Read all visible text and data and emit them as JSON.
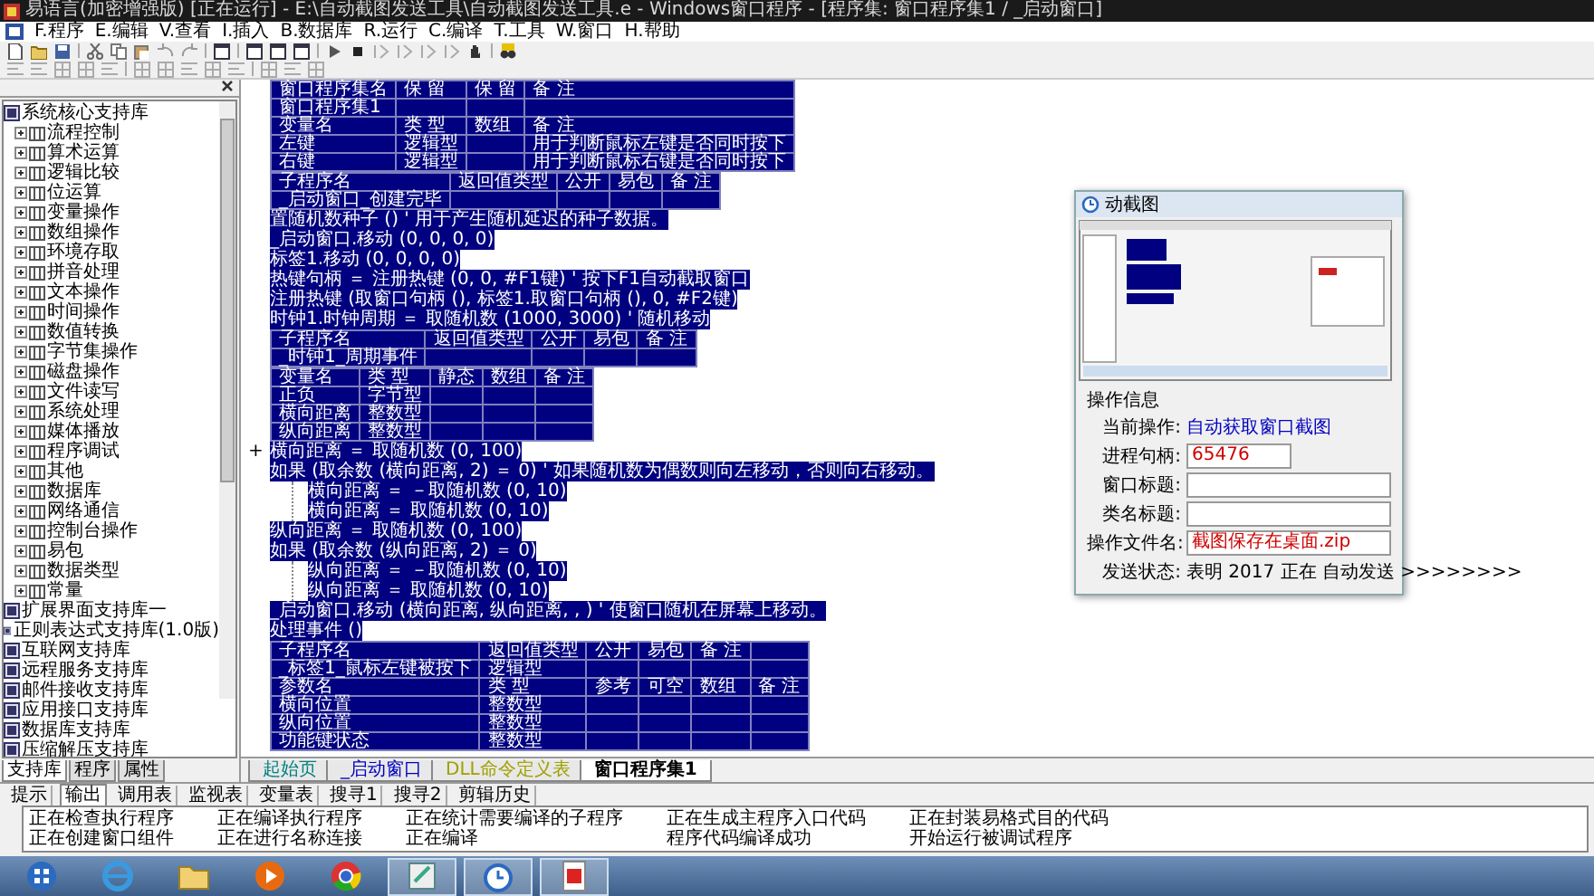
{
  "window": {
    "title": "易语言(加密增强版) [正在运行] - E:\\自动截图发送工具\\自动截图发送工具.e - Windows窗口程序 - [程序集: 窗口程序集1 / _启动窗口]"
  },
  "menu": [
    "F.程序",
    "E.编辑",
    "V.查看",
    "I.插入",
    "B.数据库",
    "R.运行",
    "C.编译",
    "T.工具",
    "W.窗口",
    "H.帮助"
  ],
  "library_panel": {
    "tree": [
      {
        "label": "系统核心支持库",
        "children": [
          {
            "label": "流程控制",
            "expanded": false
          },
          {
            "label": "算术运算",
            "expanded": false
          },
          {
            "label": "逻辑比较",
            "expanded": false
          },
          {
            "label": "位运算",
            "expanded": false
          },
          {
            "label": "变量操作",
            "expanded": false
          },
          {
            "label": "数组操作",
            "expanded": false
          },
          {
            "label": "环境存取",
            "expanded": false
          },
          {
            "label": "拼音处理",
            "expanded": false
          },
          {
            "label": "文本操作",
            "expanded": false
          },
          {
            "label": "时间操作",
            "expanded": false
          },
          {
            "label": "数值转换",
            "expanded": false
          },
          {
            "label": "字节集操作",
            "expanded": false
          },
          {
            "label": "磁盘操作",
            "expanded": false
          },
          {
            "label": "文件读写",
            "expanded": false
          },
          {
            "label": "系统处理",
            "expanded": false
          },
          {
            "label": "媒体播放",
            "expanded": false
          },
          {
            "label": "程序调试",
            "expanded": false
          },
          {
            "label": "其他",
            "expanded": false
          },
          {
            "label": "数据库",
            "expanded": false
          },
          {
            "label": "网络通信",
            "expanded": false
          },
          {
            "label": "控制台操作",
            "expanded": false
          },
          {
            "label": "易包",
            "expanded": false
          },
          {
            "label": "数据类型",
            "expanded": false
          },
          {
            "label": "常量",
            "expanded": false
          }
        ]
      },
      {
        "label": "扩展界面支持库一"
      },
      {
        "label": "正则表达式支持库(1.0版)"
      },
      {
        "label": "互联网支持库"
      },
      {
        "label": "远程服务支持库"
      },
      {
        "label": "邮件接收支持库"
      },
      {
        "label": "应用接口支持库"
      },
      {
        "label": "数据库支持库"
      },
      {
        "label": "压缩解压支持库"
      }
    ],
    "tabs": [
      {
        "label": "支持库",
        "selected": true
      },
      {
        "label": "程序",
        "selected": false
      },
      {
        "label": "属性",
        "selected": false
      }
    ]
  },
  "editor": {
    "blocks": [
      {
        "kind": "table",
        "rows": [
          {
            "cells": [
              "窗口程序集名",
              "保 留",
              "保 留",
              "备 注"
            ]
          },
          {
            "cells": [
              "窗口程序集1",
              "",
              "",
              ""
            ]
          },
          {
            "cells": [
              "变量名",
              "类 型",
              "数组",
              "备 注"
            ]
          },
          {
            "cells": [
              "左键",
              "逻辑型",
              "",
              "用于判断鼠标左键是否同时按下"
            ]
          },
          {
            "cells": [
              "右键",
              "逻辑型",
              "",
              "用于判断鼠标右键是否同时按下"
            ]
          }
        ]
      },
      {
        "kind": "table",
        "rows": [
          {
            "cells": [
              "子程序名",
              "返回值类型",
              "公开",
              "易包",
              "备 注"
            ]
          },
          {
            "cells": [
              "_启动窗口_创建完毕",
              "",
              "",
              "",
              ""
            ]
          }
        ]
      },
      {
        "kind": "line",
        "text": "置随机数种子 ()  ' 用于产生随机延迟的种子数据。"
      },
      {
        "kind": "line",
        "text": "_启动窗口.移动 (0, 0, 0, 0)"
      },
      {
        "kind": "line",
        "text": "标签1.移动 (0, 0, 0, 0)"
      },
      {
        "kind": "line",
        "text": "热键句柄 ＝ 注册热键 (0, 0, #F1键)  ' 按下F1自动截取窗口"
      },
      {
        "kind": "line",
        "text": "注册热键 (取窗口句柄 (), 标签1.取窗口句柄 (), 0, #F2键)"
      },
      {
        "kind": "line",
        "text": "时钟1.时钟周期 ＝ 取随机数 (1000, 3000)  ' 随机移动"
      },
      {
        "kind": "table",
        "rows": [
          {
            "cells": [
              "子程序名",
              "返回值类型",
              "公开",
              "易包",
              "备 注"
            ]
          },
          {
            "cells": [
              "_时钟1_周期事件",
              "",
              "",
              "",
              ""
            ]
          }
        ]
      },
      {
        "kind": "table",
        "rows": [
          {
            "cells": [
              "变量名",
              "类 型",
              "静态",
              "数组",
              "备 注"
            ]
          },
          {
            "cells": [
              "正负",
              "字节型",
              "",
              "",
              ""
            ]
          },
          {
            "cells": [
              "横向距离",
              "整数型",
              "",
              "",
              ""
            ]
          },
          {
            "cells": [
              "纵向距离",
              "整数型",
              "",
              "",
              ""
            ]
          }
        ]
      },
      {
        "kind": "line",
        "marker": "+",
        "text": "横向距离 ＝ 取随机数 (0, 100)"
      },
      {
        "kind": "line",
        "text": "如果 (取余数 (横向距离, 2) ＝ 0)  ' 如果随机数为偶数则向左移动，否则向右移动。",
        "children": [
          {
            "text": "横向距离 ＝ －取随机数 (0, 10)"
          },
          {
            "text": "横向距离 ＝ 取随机数 (0, 10)"
          }
        ]
      },
      {
        "kind": "line",
        "text": "纵向距离 ＝ 取随机数 (0, 100)"
      },
      {
        "kind": "line",
        "text": "如果 (取余数 (纵向距离, 2) ＝ 0)",
        "children": [
          {
            "text": "纵向距离 ＝ －取随机数 (0, 10)"
          },
          {
            "text": "纵向距离 ＝ 取随机数 (0, 10)"
          }
        ]
      },
      {
        "kind": "line",
        "text": "_启动窗口.移动 (横向距离, 纵向距离, , )  ' 使窗口随机在屏幕上移动。"
      },
      {
        "kind": "line",
        "text": "处理事件 ()"
      },
      {
        "kind": "table",
        "rows": [
          {
            "cells": [
              "子程序名",
              "返回值类型",
              "公开",
              "易包",
              "备 注",
              ""
            ]
          },
          {
            "cells": [
              "_标签1_鼠标左键被按下",
              "逻辑型",
              "",
              "",
              "",
              ""
            ]
          },
          {
            "cells": [
              "参数名",
              "类 型",
              "参考",
              "可空",
              "数组",
              "备 注"
            ]
          },
          {
            "cells": [
              "横向位置",
              "整数型",
              "",
              "",
              "",
              ""
            ]
          },
          {
            "cells": [
              "纵向位置",
              "整数型",
              "",
              "",
              "",
              ""
            ]
          },
          {
            "cells": [
              "功能键状态",
              "整数型",
              "",
              "",
              "",
              ""
            ]
          }
        ]
      }
    ],
    "tabs": [
      {
        "label": "起始页",
        "selected": false,
        "color": "#008080"
      },
      {
        "label": "_启动窗口",
        "selected": false,
        "color": "#0000c0"
      },
      {
        "label": "DLL命令定义表",
        "selected": false,
        "color": "#a0a000"
      },
      {
        "label": "窗口程序集1",
        "selected": true,
        "color": "#000000"
      }
    ]
  },
  "output_panel": {
    "tabs": [
      {
        "label": "提示",
        "selected": false
      },
      {
        "label": "输出",
        "selected": true
      },
      {
        "label": "调用表",
        "selected": false
      },
      {
        "label": "监视表",
        "selected": false
      },
      {
        "label": "变量表",
        "selected": false
      },
      {
        "label": "搜寻1",
        "selected": false
      },
      {
        "label": "搜寻2",
        "selected": false
      },
      {
        "label": "剪辑历史",
        "selected": false
      }
    ],
    "lines": [
      "正在检查执行程序",
      "正在创建窗口组件",
      "正在编译执行程序",
      "正在进行名称连接",
      "正在统计需要编译的子程序",
      "正在编译",
      "正在生成主程序入口代码",
      "程序代码编译成功",
      "正在封装易格式目的代码",
      "开始运行被调试程序"
    ]
  },
  "dialog": {
    "title": "动截图",
    "section": "操作信息",
    "current_action": {
      "label": "当前操作:",
      "value": "自动获取窗口截图"
    },
    "fields": [
      {
        "kind": "short",
        "label": "进程句柄:",
        "value": "65476"
      },
      {
        "kind": "long",
        "label": "窗口标题:"
      },
      {
        "kind": "long",
        "label": "类名标题:"
      },
      {
        "kind": "long",
        "label": "操作文件名:",
        "value": "截图保存在桌面.zip"
      }
    ],
    "status": {
      "label": "发送状态:",
      "value": "表明 2017 正在 自动发送 >>>>>>>>"
    }
  },
  "taskbar": {
    "items": [
      {
        "kind": "start",
        "open": false
      },
      {
        "kind": "browser",
        "open": false
      },
      {
        "kind": "folder",
        "open": false
      },
      {
        "kind": "player",
        "open": false
      },
      {
        "kind": "chrome",
        "open": false
      },
      {
        "kind": "editor",
        "open": true
      },
      {
        "kind": "clock",
        "open": true
      },
      {
        "kind": "document",
        "open": true
      }
    ]
  }
}
